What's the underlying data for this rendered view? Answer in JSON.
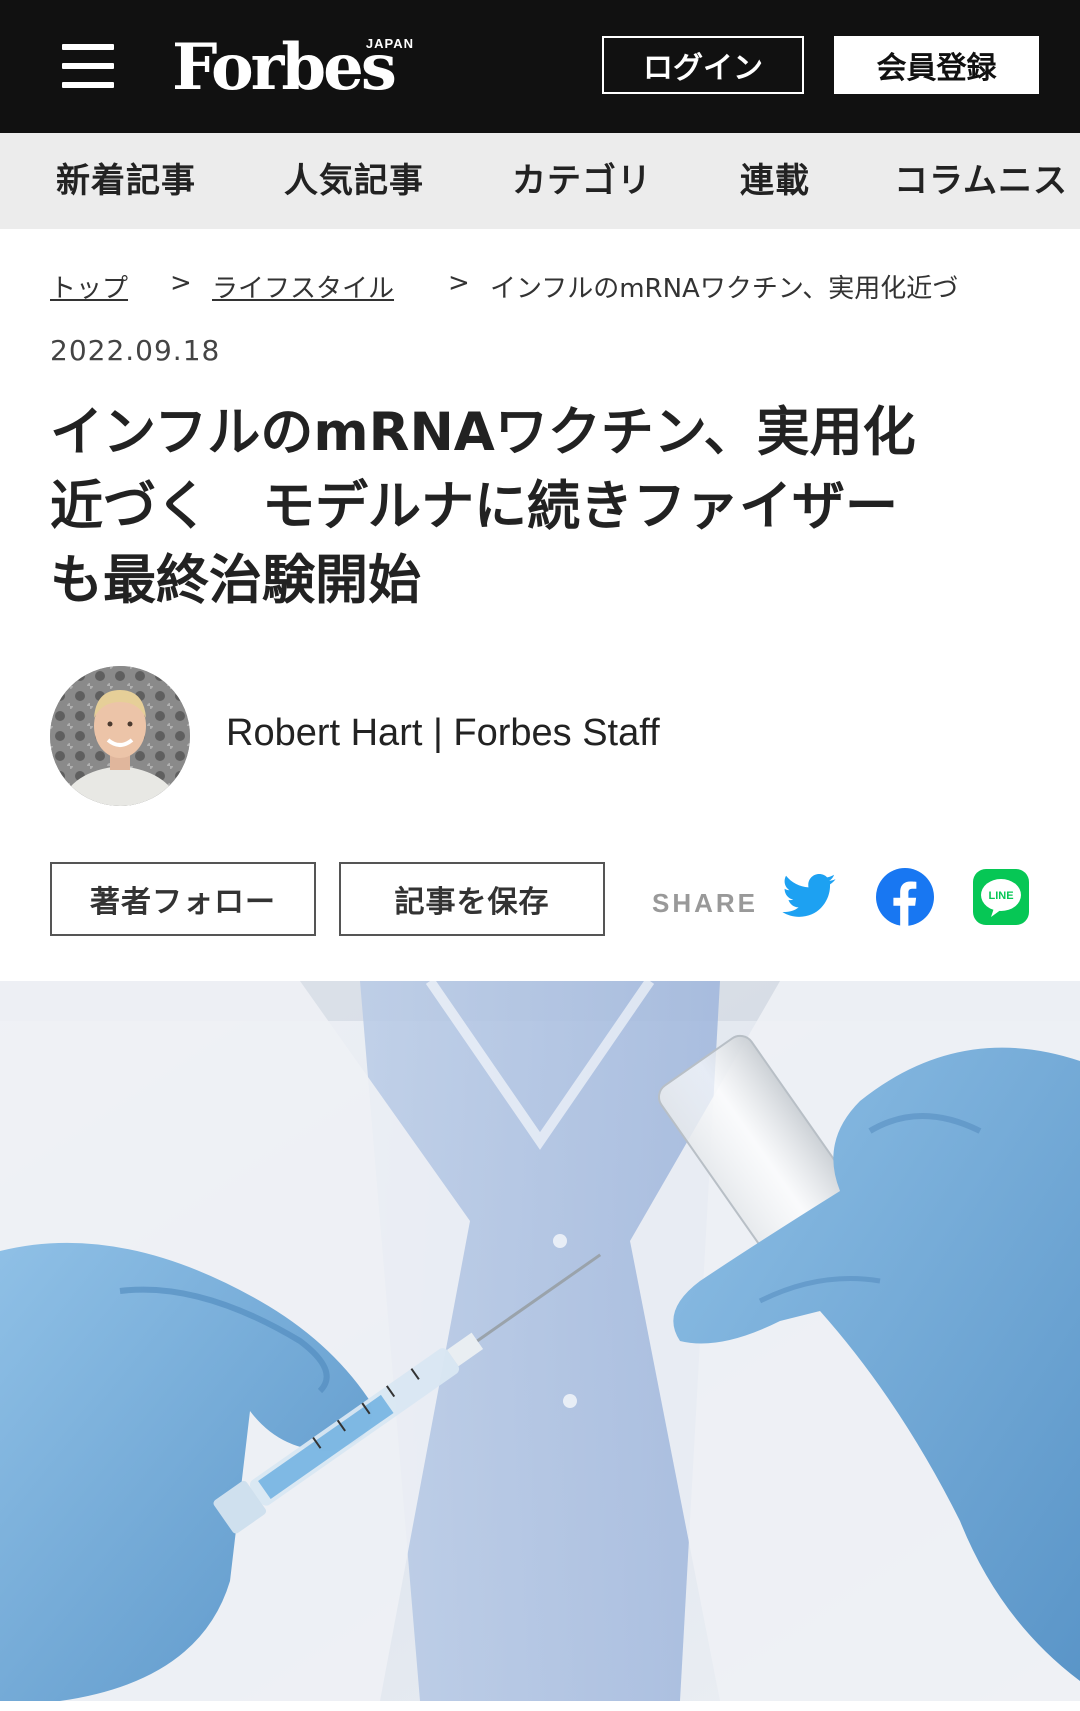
{
  "header": {
    "logo_text": "Forbes",
    "logo_subtext": "JAPAN",
    "menu_icon": "hamburger-menu-icon",
    "login_label": "ログイン",
    "signup_label": "会員登録"
  },
  "nav": {
    "items": [
      "新着記事",
      "人気記事",
      "カテゴリ",
      "連載",
      "コラムニス"
    ]
  },
  "breadcrumb": {
    "items": [
      "トップ",
      "ライフスタイル",
      "インフルのmRNAワクチン、実用化近づ"
    ],
    "separator": ">"
  },
  "article": {
    "date": "2022.09.18",
    "title_lines": [
      "インフルのmRNAワクチン、実用化",
      "近づく　モデルナに続きファイザー",
      "も最終治験開始"
    ],
    "author": "Robert Hart | Forbes Staff",
    "follow_label": "著者フォロー",
    "save_label": "記事を保存",
    "share_label": "SHARE",
    "share_icons": [
      "twitter-icon",
      "facebook-icon",
      "line-icon"
    ],
    "line_icon_text": "LINE"
  },
  "colors": {
    "header_bg": "#111111",
    "nav_bg": "#ececec",
    "twitter": "#1da1f2",
    "facebook": "#1877f2",
    "line": "#06c755"
  }
}
